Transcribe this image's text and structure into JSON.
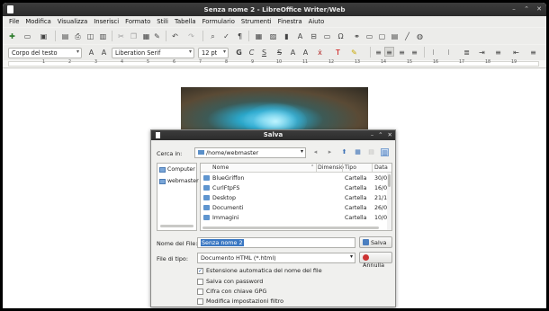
{
  "window": {
    "title": "Senza nome 2 - LibreOffice Writer/Web"
  },
  "menu": [
    "File",
    "Modifica",
    "Visualizza",
    "Inserisci",
    "Formato",
    "Stili",
    "Tabella",
    "Formulario",
    "Strumenti",
    "Finestra",
    "Aiuto"
  ],
  "formatting": {
    "paragraph_style": "Corpo del testo",
    "font_name": "Liberation Serif",
    "font_size": "12 pt"
  },
  "ruler": [
    "1",
    "2",
    "3",
    "4",
    "5",
    "6",
    "7",
    "8",
    "9",
    "10",
    "11",
    "12",
    "13",
    "14",
    "15",
    "16",
    "17",
    "18",
    "19"
  ],
  "dialog": {
    "title": "Salva",
    "look_in_label": "Cerca in:",
    "look_in_value": "/home/webmaster",
    "places": [
      {
        "label": "Computer"
      },
      {
        "label": "webmaster"
      }
    ],
    "columns": [
      "Nome",
      "Dimensio",
      "Tipo",
      "Data"
    ],
    "files": [
      {
        "name": "BlueGriffon",
        "type": "Cartella",
        "date": "30/0"
      },
      {
        "name": "CurlFtpFS",
        "type": "Cartella",
        "date": "16/0"
      },
      {
        "name": "Desktop",
        "type": "Cartella",
        "date": "21/1"
      },
      {
        "name": "Documenti",
        "type": "Cartella",
        "date": "26/0"
      },
      {
        "name": "Immagini",
        "type": "Cartella",
        "date": "10/0"
      }
    ],
    "file_name_label": "Nome del File:",
    "file_name_value": "Senza nome 2",
    "file_type_label": "File di tipo:",
    "file_type_value": "Documento HTML (*.html)",
    "save_button": "Salva",
    "cancel_button": "Annulla",
    "options": [
      {
        "label": "Estensione automatica del nome del file",
        "checked": true
      },
      {
        "label": "Salva con password",
        "checked": false
      },
      {
        "label": "Cifra con chiave GPG",
        "checked": false
      },
      {
        "label": "Modifica impostazioni filtro",
        "checked": false
      }
    ]
  }
}
